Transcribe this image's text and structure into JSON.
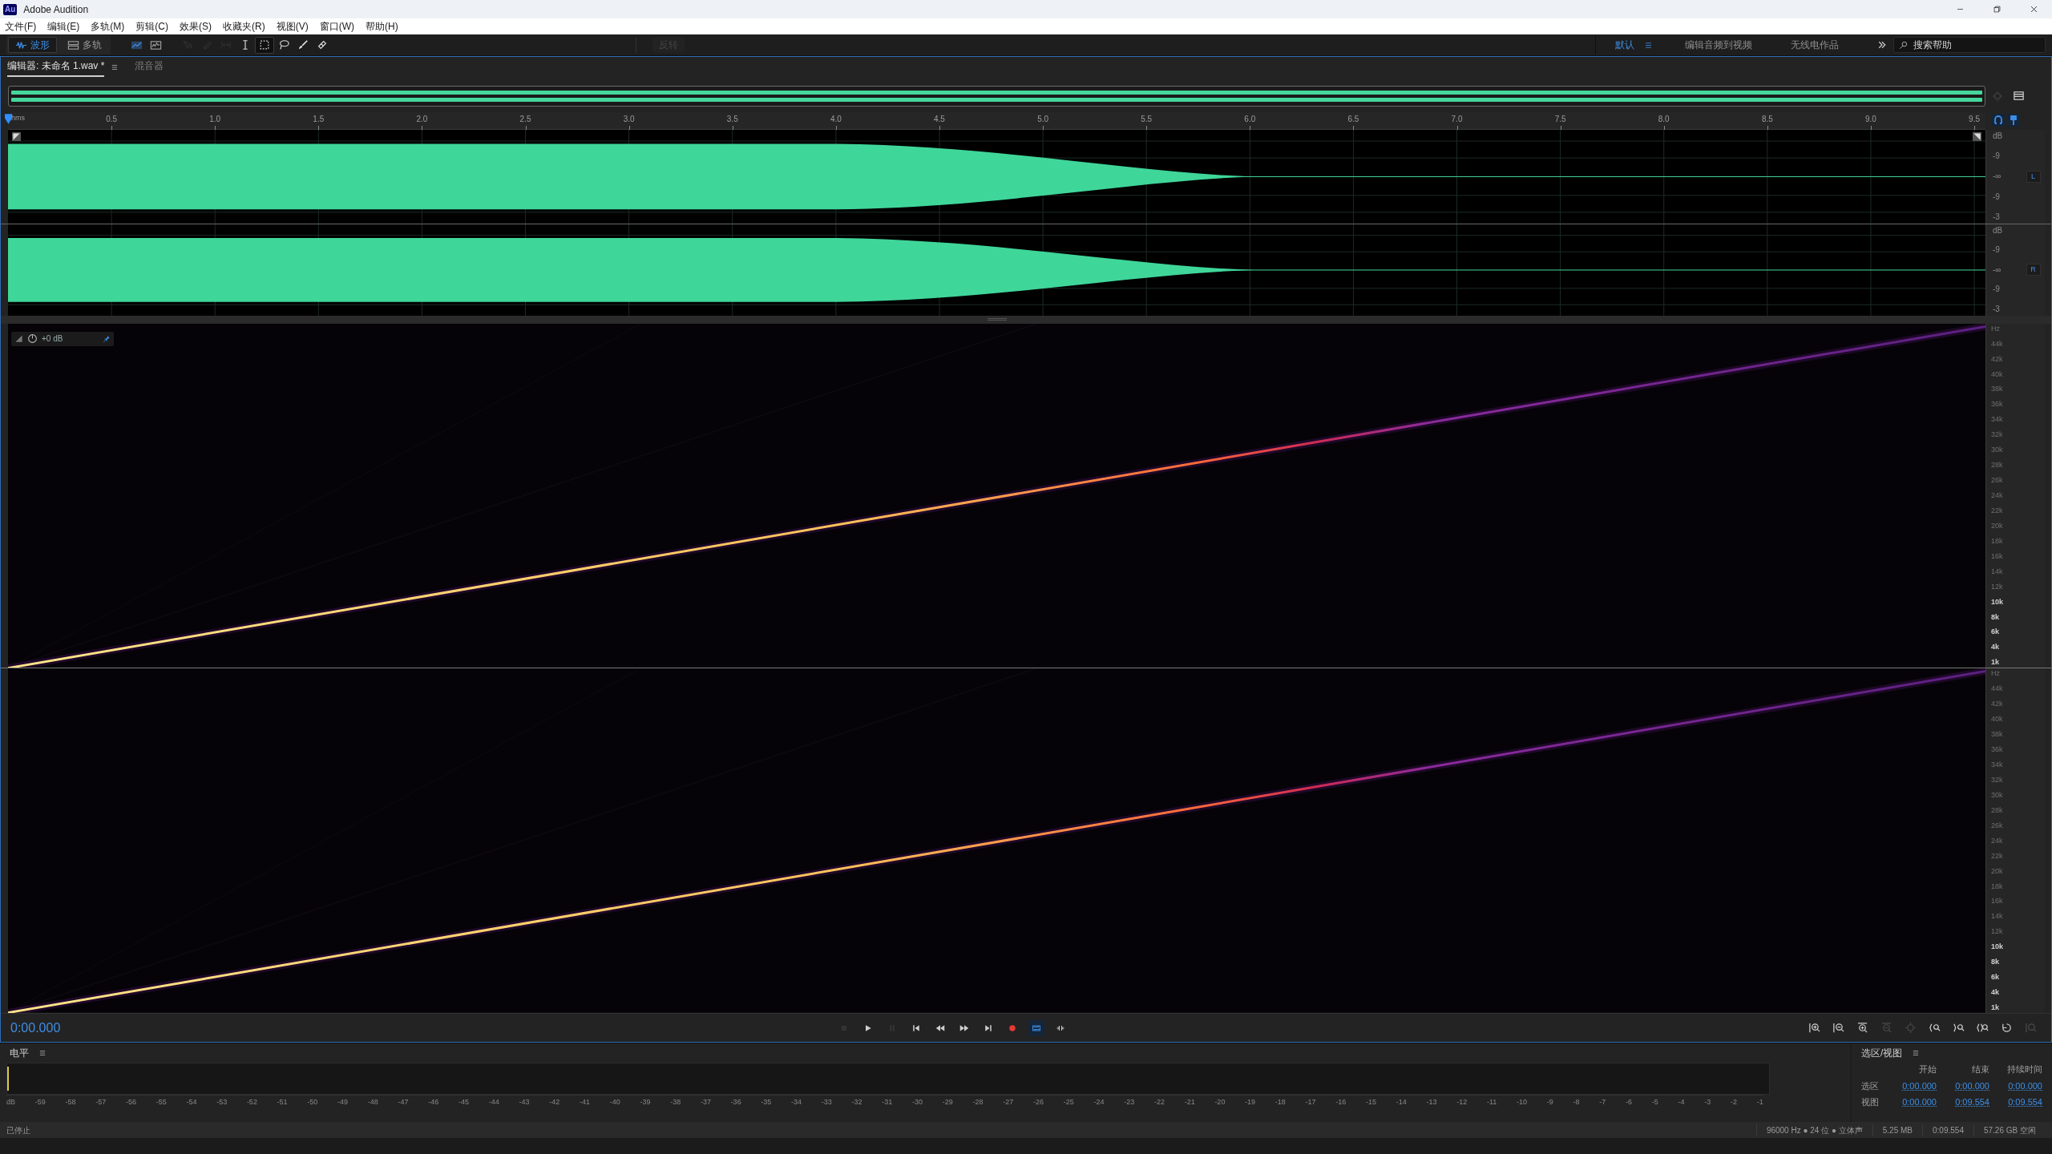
{
  "window": {
    "app_icon": "Au",
    "title": "Adobe Audition"
  },
  "menu": [
    "文件(F)",
    "编辑(E)",
    "多轨(M)",
    "剪辑(C)",
    "效果(S)",
    "收藏夹(R)",
    "视图(V)",
    "窗口(W)",
    "帮助(H)"
  ],
  "toolbar": {
    "views": [
      {
        "kind": "waveform",
        "label": "波形",
        "selected": true
      },
      {
        "kind": "multitrack",
        "label": "多轨",
        "selected": false
      }
    ],
    "display_toggles": [
      {
        "kind": "spectral-frequency",
        "on": true
      },
      {
        "kind": "spectral-pitch",
        "on": false
      }
    ],
    "tools": [
      {
        "kind": "move",
        "disabled": true,
        "selected": false
      },
      {
        "kind": "razor",
        "disabled": true,
        "selected": false
      },
      {
        "kind": "slip",
        "disabled": true,
        "selected": false
      },
      {
        "kind": "time-selection",
        "disabled": false,
        "selected": false
      },
      {
        "kind": "marquee",
        "disabled": false,
        "selected": true
      },
      {
        "kind": "lasso",
        "disabled": false,
        "selected": false
      },
      {
        "kind": "brush",
        "disabled": false,
        "selected": false
      },
      {
        "kind": "healing",
        "disabled": false,
        "selected": false
      }
    ],
    "reverse_button": {
      "label": "反转",
      "disabled": true
    },
    "workspaces": [
      {
        "label": "默认",
        "selected": true
      },
      {
        "label": "编辑音频到视频",
        "selected": false
      },
      {
        "label": "无线电作品",
        "selected": false
      }
    ],
    "search": {
      "placeholder": "搜索帮助"
    }
  },
  "editor_tabs": [
    {
      "label": "编辑器: 未命名 1.wav *",
      "selected": true
    },
    {
      "label": "混音器",
      "selected": false
    }
  ],
  "ruler": {
    "unit": "hms",
    "ticks": [
      "0.5",
      "1.0",
      "1.5",
      "2.0",
      "2.5",
      "3.0",
      "3.5",
      "4.0",
      "4.5",
      "5.0",
      "5.5",
      "6.0",
      "6.5",
      "7.0",
      "7.5",
      "8.0",
      "8.5",
      "9.0",
      "9.5"
    ]
  },
  "waveform": {
    "channels": [
      {
        "label": "L",
        "scale": [
          "dB",
          "-9",
          "-∞",
          "-9",
          "-3"
        ]
      },
      {
        "label": "R",
        "scale": [
          "dB",
          "-9",
          "-∞",
          "-9",
          "-3"
        ]
      }
    ]
  },
  "spectrogram": {
    "gain": "+0 dB",
    "channels": [
      {
        "scale": [
          "Hz",
          "44k",
          "42k",
          "40k",
          "38k",
          "36k",
          "34k",
          "32k",
          "30k",
          "28k",
          "26k",
          "24k",
          "22k",
          "20k",
          "18k",
          "16k",
          "14k",
          "12k",
          "10k",
          "8k",
          "6k",
          "4k",
          "1k"
        ]
      },
      {
        "scale": [
          "Hz",
          "44k",
          "42k",
          "40k",
          "38k",
          "36k",
          "34k",
          "32k",
          "30k",
          "28k",
          "26k",
          "24k",
          "22k",
          "20k",
          "18k",
          "16k",
          "14k",
          "12k",
          "10k",
          "8k",
          "6k",
          "4k",
          "1k"
        ]
      }
    ]
  },
  "transport": {
    "time": "0:00.000",
    "buttons": [
      {
        "kind": "stop",
        "disabled": true,
        "on": false
      },
      {
        "kind": "play",
        "disabled": false,
        "on": false
      },
      {
        "kind": "pause",
        "disabled": true,
        "on": false
      },
      {
        "kind": "to-start",
        "disabled": false,
        "on": false
      },
      {
        "kind": "rewind",
        "disabled": false,
        "on": false
      },
      {
        "kind": "fast-forward",
        "disabled": false,
        "on": false
      },
      {
        "kind": "to-end",
        "disabled": false,
        "on": false
      },
      {
        "kind": "record",
        "disabled": false,
        "on": false
      },
      {
        "kind": "loop",
        "disabled": false,
        "on": true
      },
      {
        "kind": "skip",
        "disabled": false,
        "on": false
      }
    ]
  },
  "zoom_buttons": [
    {
      "kind": "zoom-in-amplitude",
      "disabled": false
    },
    {
      "kind": "zoom-out-amplitude",
      "disabled": false
    },
    {
      "kind": "zoom-in-time",
      "disabled": false
    },
    {
      "kind": "zoom-out-time",
      "disabled": true
    },
    {
      "kind": "zoom-out-full",
      "disabled": true
    },
    {
      "kind": "zoom-selection-in",
      "disabled": false
    },
    {
      "kind": "zoom-selection-out",
      "disabled": false
    },
    {
      "kind": "zoom-selection",
      "disabled": false
    },
    {
      "kind": "zoom-reset",
      "disabled": false
    },
    {
      "kind": "zoom-amplitude-selection",
      "disabled": true
    }
  ],
  "levels": {
    "title": "电平",
    "scale": [
      "dB",
      "-59",
      "-58",
      "-57",
      "-56",
      "-55",
      "-54",
      "-53",
      "-52",
      "-51",
      "-50",
      "-49",
      "-48",
      "-47",
      "-46",
      "-45",
      "-44",
      "-43",
      "-42",
      "-41",
      "-40",
      "-39",
      "-38",
      "-37",
      "-36",
      "-35",
      "-34",
      "-33",
      "-32",
      "-31",
      "-30",
      "-29",
      "-28",
      "-27",
      "-26",
      "-25",
      "-24",
      "-23",
      "-22",
      "-21",
      "-20",
      "-19",
      "-18",
      "-17",
      "-16",
      "-15",
      "-14",
      "-13",
      "-12",
      "-11",
      "-10",
      "-9",
      "-8",
      "-7",
      "-6",
      "-5",
      "-4",
      "-3",
      "-2",
      "-1"
    ]
  },
  "selection_view": {
    "title": "选区/视图",
    "headers": [
      "开始",
      "结束",
      "持续时间"
    ],
    "rows": [
      {
        "label": "选区",
        "values": [
          "0:00.000",
          "0:00.000",
          "0:00.000"
        ]
      },
      {
        "label": "视图",
        "values": [
          "0:00.000",
          "0:09.554",
          "0:09.554"
        ]
      }
    ]
  },
  "status_bar": {
    "state": "已停止",
    "items": [
      "96000 Hz ● 24 位 ● 立体声",
      "5.25 MB",
      "0:09.554",
      "57.26 GB 空闲"
    ]
  }
}
